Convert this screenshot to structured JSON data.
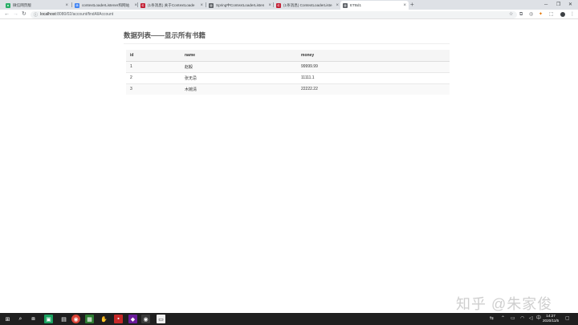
{
  "browser": {
    "tabs": [
      {
        "title": "微信网页版",
        "favicon_color": "#2aae67",
        "favicon_glyph": "●",
        "active": false
      },
      {
        "title": "contextLoaderListener和网站",
        "favicon_color": "#4285f4",
        "favicon_glyph": "G",
        "active": false
      },
      {
        "title": "(1条消息) 关于ContextLoade",
        "favicon_color": "#c32136",
        "favicon_glyph": "C",
        "active": false
      },
      {
        "title": "Spring中ContextLoaderListen",
        "favicon_color": "#5f6368",
        "favicon_glyph": "◍",
        "active": false
      },
      {
        "title": "(1条消息) ContextLoaderListe",
        "favicon_color": "#c32136",
        "favicon_glyph": "C",
        "active": false
      },
      {
        "title": "ETBd1",
        "favicon_color": "#5f6368",
        "favicon_glyph": "◍",
        "active": true
      }
    ],
    "new_tab_glyph": "+",
    "url_host": "localhost",
    "url_path": ":8080/02/account/findAllAccount"
  },
  "page": {
    "heading": "数据列表——显示所有书籍",
    "table": {
      "headers": [
        "id",
        "name",
        "money"
      ],
      "rows": [
        [
          "1",
          "赵毅",
          "99999.99"
        ],
        [
          "2",
          "张无忌",
          "11111.1"
        ],
        [
          "3",
          "木婉清",
          "22222.22"
        ]
      ]
    }
  },
  "watermark": "知乎 @朱家俊",
  "taskbar": {
    "time": "14:27",
    "date": "2020/11/5"
  }
}
